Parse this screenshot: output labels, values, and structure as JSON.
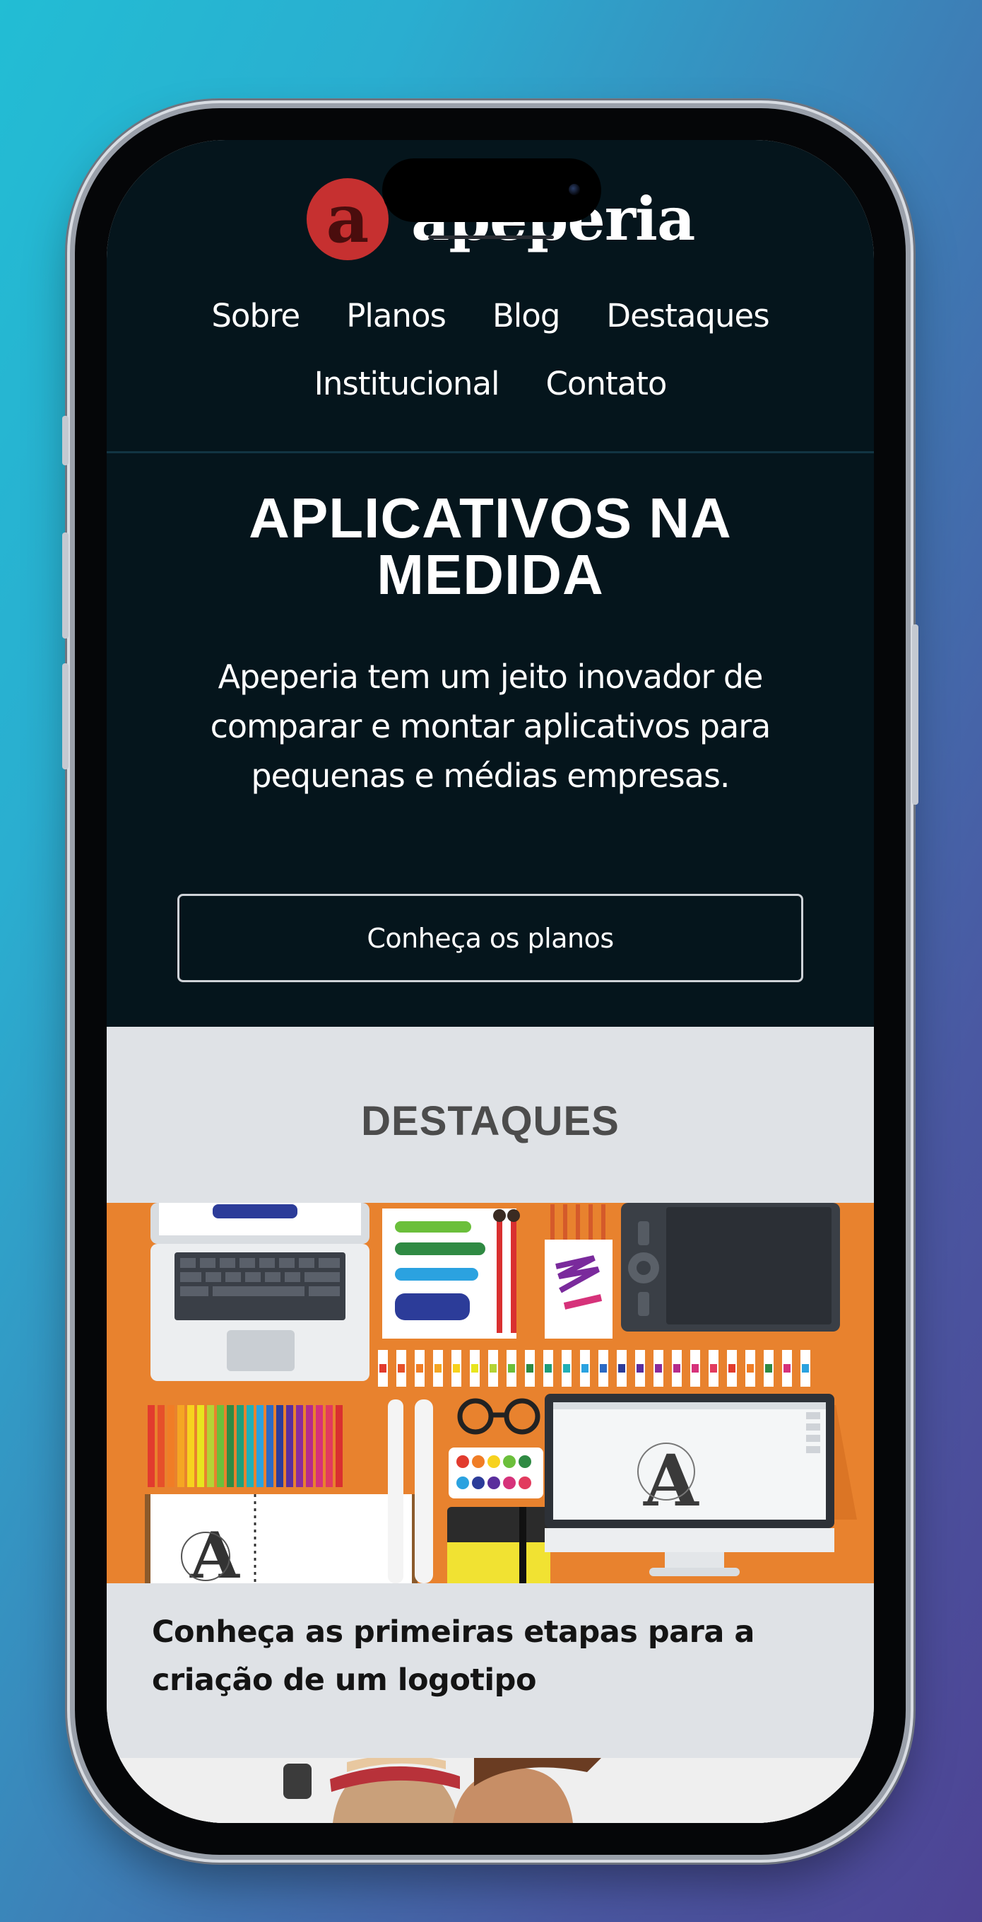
{
  "brand": {
    "name": "apeperia",
    "mark_letter": "a",
    "mark_color": "#c63030"
  },
  "nav": {
    "items": [
      "Sobre",
      "Planos",
      "Blog",
      "Destaques",
      "Institucional",
      "Contato"
    ]
  },
  "hero": {
    "title_line1": "APLICATIVOS NA",
    "title_line2": "MEDIDA",
    "subtitle_line1": "Apeperia tem um jeito inovador de",
    "subtitle_line2": "comparar e montar aplicativos para",
    "subtitle_line3": "pequenas e médias empresas.",
    "cta_label": "Conheça os planos"
  },
  "highlights": {
    "section_title": "DESTAQUES",
    "featured_card": {
      "title_line1": "Conheça as primeiras etapas para a",
      "title_line2": "criação de um logotipo",
      "illustration_letter": "A"
    }
  },
  "colors": {
    "header_bg": "#05151c",
    "section_bg": "#dfe2e6",
    "illustration_bg": "#e8822e",
    "page_gradient_start": "#22bdd4",
    "page_gradient_end": "#4e4394"
  }
}
